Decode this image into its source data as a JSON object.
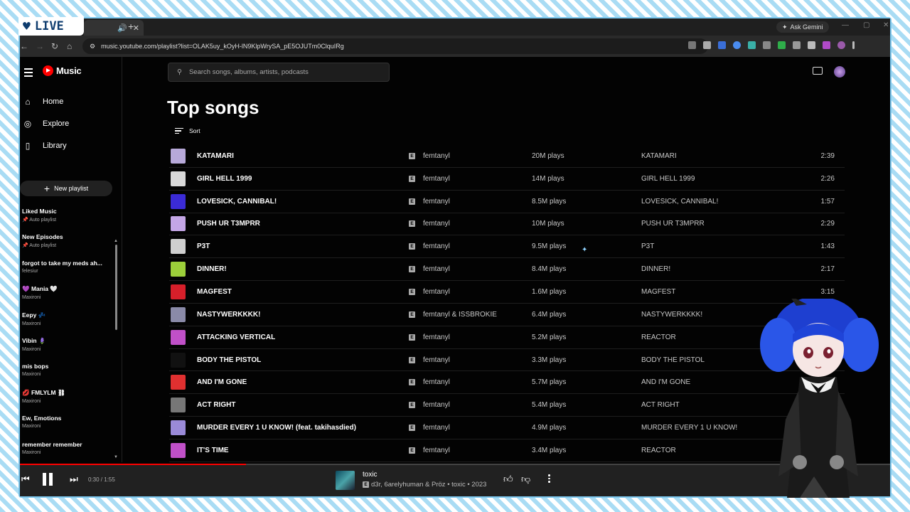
{
  "badge": {
    "label": "LIVE"
  },
  "browser": {
    "url": "music.youtube.com/playlist?list=OLAK5uy_kOyH-lN9KlpWrySA_pE5OJUTm0ClquIRg",
    "ask_gemini": "Ask Gemini"
  },
  "app": {
    "name": "Music",
    "search_placeholder": "Search songs, albums, artists, podcasts"
  },
  "sidebar": {
    "nav": [
      {
        "label": "Home",
        "icon": "home-icon"
      },
      {
        "label": "Explore",
        "icon": "explore-icon"
      },
      {
        "label": "Library",
        "icon": "library-icon"
      }
    ],
    "new_playlist": "New playlist",
    "playlists": [
      {
        "title": "Liked Music",
        "sub": "📌 Auto playlist"
      },
      {
        "title": "New Episodes",
        "sub": "📌 Auto playlist"
      },
      {
        "title": "forgot to take my meds ah...",
        "sub": "felesiur"
      },
      {
        "title": "💜 Mania 🤍",
        "sub": "Maxironi"
      },
      {
        "title": "Eepy 💤",
        "sub": "Maxironi"
      },
      {
        "title": "Vibin 🪻",
        "sub": "Maxironi"
      },
      {
        "title": "mis bops",
        "sub": "Maxironi"
      },
      {
        "title": "💋 FMLYLM ⛓",
        "sub": "Maxironi"
      },
      {
        "title": "Ew, Emotions",
        "sub": "Maxironi"
      },
      {
        "title": "remember remember",
        "sub": "Maxironi"
      }
    ]
  },
  "main": {
    "title": "Top songs",
    "sort_label": "Sort",
    "songs": [
      {
        "title": "KATAMARI",
        "artist": "femtanyl",
        "plays": "20M plays",
        "album": "KATAMARI",
        "duration": "2:39",
        "thumb": "#b7a9d9"
      },
      {
        "title": "GIRL HELL 1999",
        "artist": "femtanyl",
        "plays": "14M plays",
        "album": "GIRL HELL 1999",
        "duration": "2:26",
        "thumb": "#d8d8d8"
      },
      {
        "title": "LOVESICK, CANNIBAL!",
        "artist": "femtanyl",
        "plays": "8.5M plays",
        "album": "LOVESICK, CANNIBAL!",
        "duration": "1:57",
        "thumb": "#3b2bd6"
      },
      {
        "title": "PUSH UR T3MPRR",
        "artist": "femtanyl",
        "plays": "10M plays",
        "album": "PUSH UR T3MPRR",
        "duration": "2:29",
        "thumb": "#c4a6e6"
      },
      {
        "title": "P3T",
        "artist": "femtanyl",
        "plays": "9.5M plays",
        "album": "P3T",
        "duration": "1:43",
        "thumb": "#cfcfcf"
      },
      {
        "title": "DINNER!",
        "artist": "femtanyl",
        "plays": "8.4M plays",
        "album": "DINNER!",
        "duration": "2:17",
        "thumb": "#9ccf3a"
      },
      {
        "title": "MAGFEST",
        "artist": "femtanyl",
        "plays": "1.6M plays",
        "album": "MAGFEST",
        "duration": "3:15",
        "thumb": "#d61f2a"
      },
      {
        "title": "NASTYWERKKKK!",
        "artist": "femtanyl & ISSBROKIE",
        "plays": "6.4M plays",
        "album": "NASTYWERKKKK!",
        "duration": "",
        "thumb": "#8a8aa8"
      },
      {
        "title": "ATTACKING VERTICAL",
        "artist": "femtanyl",
        "plays": "5.2M plays",
        "album": "REACTOR",
        "duration": "",
        "thumb": "#c050c8"
      },
      {
        "title": "BODY THE PISTOL",
        "artist": "femtanyl",
        "plays": "3.3M plays",
        "album": "BODY THE PISTOL",
        "duration": "",
        "thumb": "#111111"
      },
      {
        "title": "AND I'M GONE",
        "artist": "femtanyl",
        "plays": "5.7M plays",
        "album": "AND I'M GONE",
        "duration": "",
        "thumb": "#e03030"
      },
      {
        "title": "ACT RIGHT",
        "artist": "femtanyl",
        "plays": "5.4M plays",
        "album": "ACT RIGHT",
        "duration": "",
        "thumb": "#777777"
      },
      {
        "title": "MURDER EVERY 1 U KNOW! (feat. takihasdied)",
        "artist": "femtanyl",
        "plays": "4.9M plays",
        "album": "MURDER EVERY 1 U KNOW!",
        "duration": "",
        "thumb": "#9a8ad8"
      },
      {
        "title": "IT'S TIME",
        "artist": "femtanyl",
        "plays": "3.4M plays",
        "album": "REACTOR",
        "duration": "",
        "thumb": "#c050c8"
      }
    ]
  },
  "player": {
    "time": "0:30 / 1:55",
    "progress": 0.26,
    "title": "toxic",
    "subtitle": "d3r, 6arelyhuman & Pröz • toxic • 2023",
    "explicit": "E"
  },
  "colors": {
    "accent": "#ff0000",
    "frame": "#7cc8ef",
    "background": "#030303"
  }
}
